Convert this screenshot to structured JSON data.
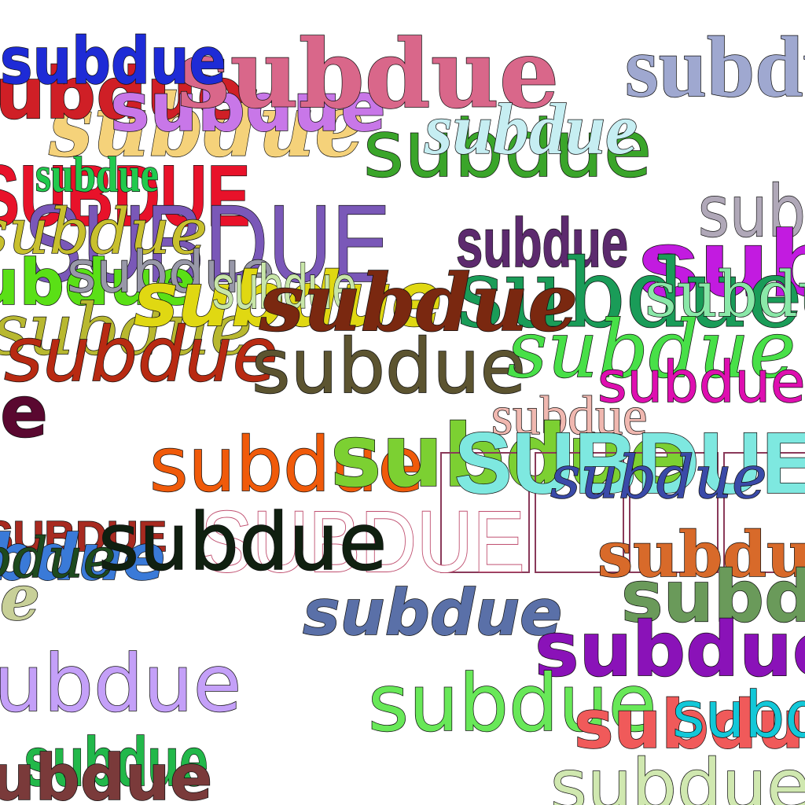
{
  "word": "subdue",
  "words": [
    {
      "text": "subdue",
      "color": "#f5d27a"
    },
    {
      "text": "subdue",
      "color": "#cf1f26"
    },
    {
      "text": "subdue",
      "color": "#1e2bd6"
    },
    {
      "text": "subdue",
      "color": "#c877e8"
    },
    {
      "text": "subdue",
      "color": "#d9678a"
    },
    {
      "text": "subdue",
      "color": "#9fa8d0"
    },
    {
      "text": "subdue",
      "color": "#3aa52a"
    },
    {
      "text": "subdue",
      "color": "#c6eef2"
    },
    {
      "text": "subdue",
      "color": "#22c94d"
    },
    {
      "text": "SUBDUE",
      "color": "#e8122a"
    },
    {
      "text": "SUBDUE",
      "color": "#7a58b8"
    },
    {
      "text": "subdue",
      "color": "#b0a8b8"
    },
    {
      "text": "subdue",
      "color": "#5c2a6e"
    },
    {
      "text": "subdue",
      "color": "#c21be0"
    },
    {
      "text": "subdue",
      "color": "#5ae016"
    },
    {
      "text": "subdue",
      "color": "#c8c02e"
    },
    {
      "text": "subdue",
      "color": "#c8e6a8"
    },
    {
      "text": "subdue",
      "color": "#e0d812"
    },
    {
      "text": "subdue",
      "color": "#7a2810"
    },
    {
      "text": "subdue",
      "color": "#1a9c58"
    },
    {
      "text": "subdue",
      "color": "#8ae8a8"
    },
    {
      "text": "subdue",
      "color": "#b82a12"
    },
    {
      "text": "subdue",
      "color": "#5c5430"
    },
    {
      "text": "subdue",
      "color": "#48e048"
    },
    {
      "text": "subdue",
      "color": "#de0fb0"
    },
    {
      "text": "subdue",
      "color": "#5a0830"
    },
    {
      "text": "subdue",
      "color": "#f0b8b0"
    },
    {
      "text": "subdue",
      "color": "#f05a0a"
    },
    {
      "text": "subdue",
      "color": "#7cd032"
    },
    {
      "text": "SUBDUE",
      "color": "#7ee8e0"
    },
    {
      "text": "subdue",
      "color": "#3a4aa8"
    },
    {
      "text": "SUBDUE",
      "color": "#d04a70"
    },
    {
      "text": "SUBDUE",
      "color": "#a82a20"
    },
    {
      "text": "subdue",
      "color": "#3a7ad8"
    },
    {
      "text": "subdue",
      "color": "#1e4a1e"
    },
    {
      "text": "subdue",
      "color": "#102010"
    },
    {
      "text": "subdue",
      "color": "#5a70a8"
    },
    {
      "text": "subdue",
      "color": "#c8d098"
    },
    {
      "text": "subdue",
      "color": "#d86a2a"
    },
    {
      "text": "subdue",
      "color": "#6a9a5a"
    },
    {
      "text": "subdue",
      "color": "#8a12b8"
    },
    {
      "text": "subdue",
      "color": "#c4a0f8"
    },
    {
      "text": "subdue",
      "color": "#68e858"
    },
    {
      "text": "subdue",
      "color": "#f05a5a"
    },
    {
      "text": "subdue",
      "color": "#12c8d8"
    },
    {
      "text": "subdue",
      "color": "#22b84a"
    },
    {
      "text": "subdue",
      "color": "#7a3a3a"
    },
    {
      "text": "subdue",
      "color": "#d0e8b0"
    }
  ]
}
